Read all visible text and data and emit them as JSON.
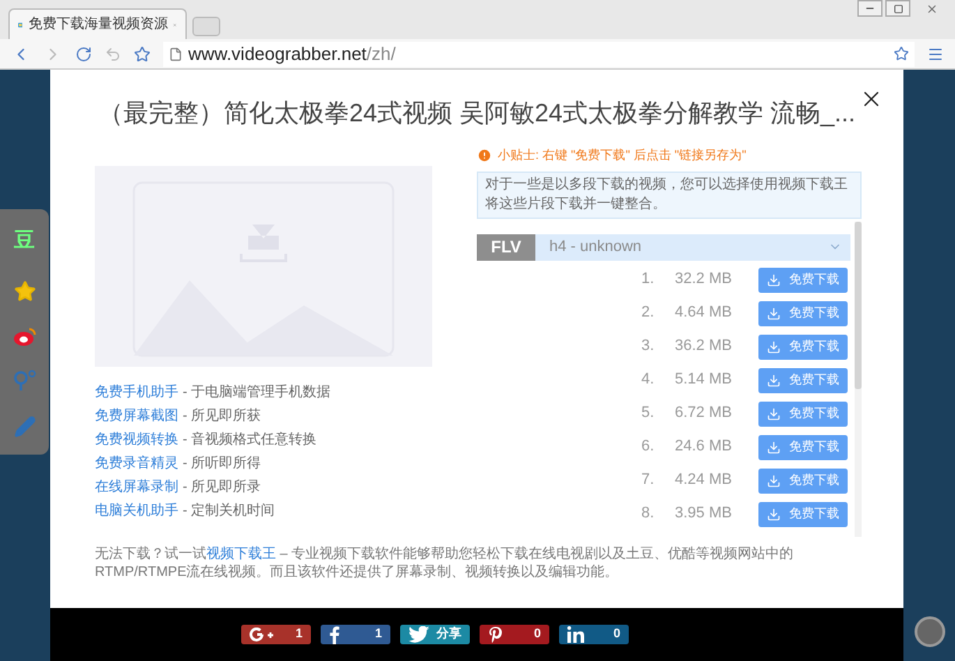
{
  "browser": {
    "tab_title": "免费下载海量视频资源",
    "url_host": "www.videograbber.net",
    "url_path": "/zh/"
  },
  "sidebar": [
    {
      "kind": "text",
      "label": "豆"
    },
    {
      "kind": "star"
    },
    {
      "kind": "weibo"
    },
    {
      "kind": "qq"
    },
    {
      "kind": "pen"
    }
  ],
  "modal": {
    "title": "（最完整）简化太极拳24式视频 吴阿敏24式太极拳分解教学 流畅_...",
    "tip": "小贴士: 右键 \"免费下载\" 后点击 \"链接另存为\"",
    "info": "对于一些是以多段下载的视频，您可以选择使用视频下载王将这些片段下载并一键整合。",
    "format": "FLV",
    "quality": "h4 - unknown",
    "files": [
      {
        "index": "1.",
        "size": "32.2 MB",
        "button": "免费下载"
      },
      {
        "index": "2.",
        "size": "4.64 MB",
        "button": "免费下载"
      },
      {
        "index": "3.",
        "size": "36.2 MB",
        "button": "免费下载"
      },
      {
        "index": "4.",
        "size": "5.14 MB",
        "button": "免费下载"
      },
      {
        "index": "5.",
        "size": "6.72 MB",
        "button": "免费下载"
      },
      {
        "index": "6.",
        "size": "24.6 MB",
        "button": "免费下载"
      },
      {
        "index": "7.",
        "size": "4.24 MB",
        "button": "免费下载"
      },
      {
        "index": "8.",
        "size": "3.95 MB",
        "button": "免费下载"
      }
    ],
    "links": [
      {
        "name": "免费手机助手",
        "desc": "- 于电脑端管理手机数据"
      },
      {
        "name": "免费屏幕截图",
        "desc": "- 所见即所获"
      },
      {
        "name": "免费视频转换",
        "desc": "- 音视频格式任意转换"
      },
      {
        "name": "免费录音精灵",
        "desc": "- 所听即所得"
      },
      {
        "name": "在线屏幕录制",
        "desc": "- 所见即所录"
      },
      {
        "name": "电脑关机助手",
        "desc": "- 定制关机时间"
      }
    ],
    "footer": {
      "before": "无法下载？试一试",
      "link": "视频下载王",
      "after": " – 专业视频下载软件能够帮助您轻松下载在线电视剧以及土豆、优酷等视频网站中的RTMP/RTMPE流在线视频。而且该软件还提供了屏幕录制、视频转换以及编辑功能。"
    }
  },
  "share": [
    {
      "kind": "googleplus",
      "count": "1"
    },
    {
      "kind": "facebook",
      "count": "1"
    },
    {
      "kind": "twitter",
      "count": "分享"
    },
    {
      "kind": "pinterest",
      "count": "0"
    },
    {
      "kind": "linkedin",
      "count": "0"
    }
  ]
}
